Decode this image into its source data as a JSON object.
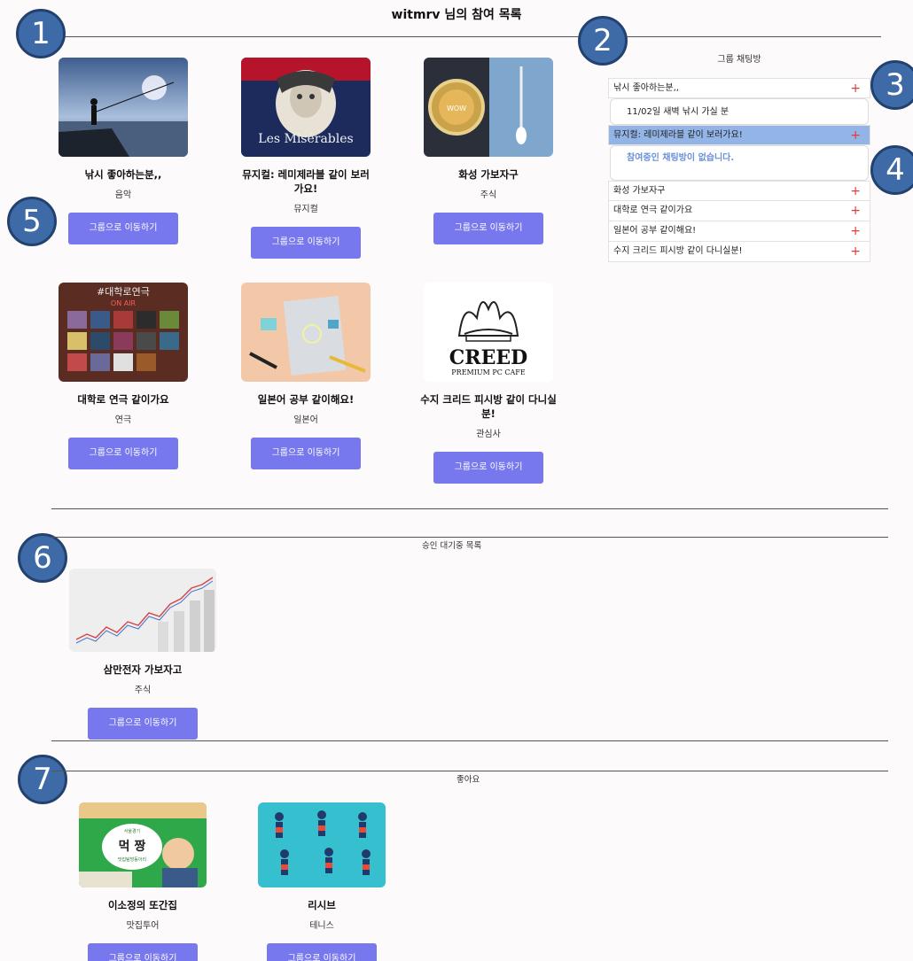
{
  "page": {
    "title": "witmrv 님의 참여 목록"
  },
  "callouts": [
    "1",
    "2",
    "3",
    "4",
    "5",
    "6",
    "7"
  ],
  "joined": [
    {
      "title": "낚시 좋아하는분,,",
      "category": "음악",
      "button": "그룹으로 이동하기",
      "thumb": "fishing-sunset"
    },
    {
      "title": "뮤지컬: 레미제라블 같이 보러가요!",
      "category": "뮤지컬",
      "button": "그룹으로 이동하기",
      "thumb": "les-miserables-poster"
    },
    {
      "title": "화성 가보자구",
      "category": "주식",
      "button": "그룹으로 이동하기",
      "thumb": "doge-rocket"
    },
    {
      "title": "대학로 연극 같이가요",
      "category": "연극",
      "button": "그룹으로 이동하기",
      "thumb": "theater-wall"
    },
    {
      "title": "일본어 공부 같이해요!",
      "category": "일본어",
      "button": "그룹으로 이동하기",
      "thumb": "study-notebook"
    },
    {
      "title": "수지 크리드 피시방 같이 다니실분!",
      "category": "관심사",
      "button": "그룹으로 이동하기",
      "thumb": "creed-logo"
    }
  ],
  "creed_logo": {
    "brand": "CREED",
    "tagline": "PREMIUM PC CAFE"
  },
  "les_mis": {
    "title": "Les Misérables"
  },
  "theater_sign": {
    "hashtag": "#대학로연극",
    "onair": "ON AIR"
  },
  "doge_coin": {
    "text": "WOW"
  },
  "chat": {
    "heading": "그룹 채팅방",
    "rooms": [
      {
        "name": "낚시 좋아하는분,,",
        "action": "+"
      },
      {
        "name": "뮤지컬: 레미제라블 같이 보러가요!",
        "action": "+"
      },
      {
        "name": "화성 가보자구",
        "action": "+"
      },
      {
        "name": "대학로 연극 같이가요",
        "action": "+"
      },
      {
        "name": "일본어 공부 같이해요!",
        "action": "+"
      },
      {
        "name": "수지 크리드 피시방 같이 다니실분!",
        "action": "+"
      }
    ],
    "sub_room": "11/02일 새벽 낚시 가실 분",
    "empty_message": "참여중인 채팅방이 없습니다."
  },
  "pending": {
    "label": "승인 대기중 목록",
    "items": [
      {
        "title": "삼만전자 가보자고",
        "category": "주식",
        "button": "그룹으로 이동하기",
        "thumb": "stock-chart"
      }
    ]
  },
  "liked": {
    "label": "좋아요",
    "items": [
      {
        "title": "이소정의 또간집",
        "category": "맛집투어",
        "button": "그룹으로 이동하기",
        "thumb": "mukbang-cartoon"
      },
      {
        "title": "리시브",
        "category": "테니스",
        "button": "그룹으로 이동하기",
        "thumb": "sports-players"
      }
    ]
  },
  "mukbang_badge": {
    "top": "서울경기",
    "main": "먹 짱",
    "sub": "맛집탐방동아리"
  },
  "colors": {
    "button": "#7878ee",
    "active_row": "#93b4e6",
    "plus": "#e03c3c",
    "callout": "#3e6aa8"
  }
}
